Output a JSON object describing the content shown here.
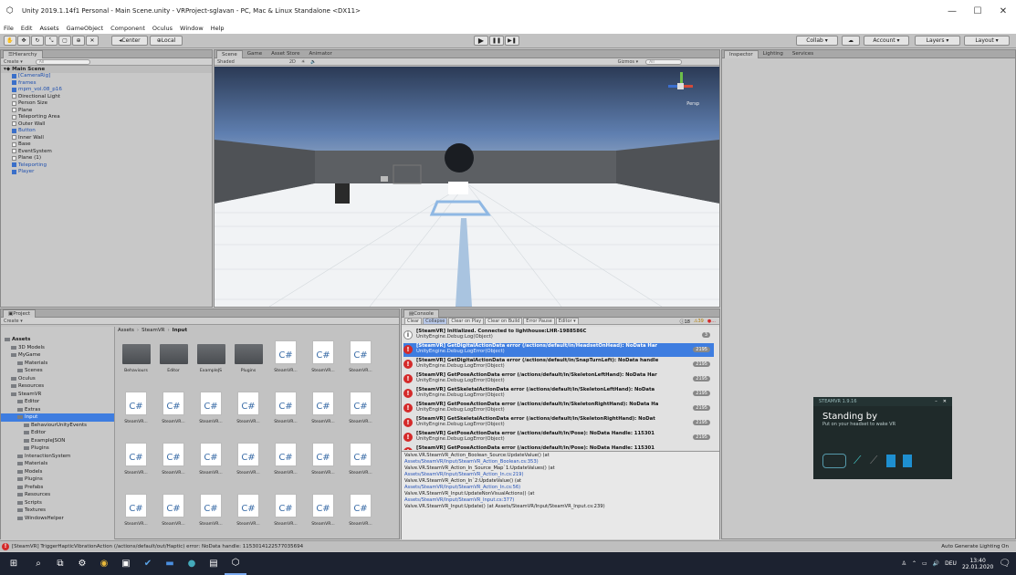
{
  "window": {
    "title": "Unity 2019.1.14f1 Personal - Main Scene.unity - VRProject-sglavan - PC, Mac & Linux Standalone <DX11>",
    "controls": {
      "minimize": "—",
      "maximize": "☐",
      "close": "✕"
    }
  },
  "menu": [
    "File",
    "Edit",
    "Assets",
    "GameObject",
    "Component",
    "Oculus",
    "Window",
    "Help"
  ],
  "toolbar": {
    "pivot": "Center",
    "space": "Local",
    "collab": "Collab ▾",
    "account": "Account ▾",
    "layers": "Layers ▾",
    "layout": "Layout ▾",
    "play": "▶",
    "pause": "❚❚",
    "step": "▶❚"
  },
  "hierarchy": {
    "tab": "Hierarchy",
    "create": "Create ▾",
    "search_placeholder": "All",
    "scene": "Main Scene",
    "items": [
      {
        "label": "[CameraRig]",
        "indent": 1,
        "blue": true
      },
      {
        "label": "frames",
        "indent": 1,
        "blue": true
      },
      {
        "label": "mpm_vol.08_p16",
        "indent": 1,
        "blue": true
      },
      {
        "label": "Directional Light",
        "indent": 1,
        "blue": false
      },
      {
        "label": "Person Size",
        "indent": 1,
        "blue": false
      },
      {
        "label": "Plane",
        "indent": 1,
        "blue": false
      },
      {
        "label": "Teleporting Area",
        "indent": 1,
        "blue": false
      },
      {
        "label": "Outer Wall",
        "indent": 1,
        "blue": false
      },
      {
        "label": "Button",
        "indent": 1,
        "blue": true
      },
      {
        "label": "Inner Wall",
        "indent": 1,
        "blue": false
      },
      {
        "label": "Base",
        "indent": 1,
        "blue": false
      },
      {
        "label": "EventSystem",
        "indent": 1,
        "blue": false
      },
      {
        "label": "Plane (1)",
        "indent": 1,
        "blue": false
      },
      {
        "label": "Teleporting",
        "indent": 1,
        "blue": true
      },
      {
        "label": "Player",
        "indent": 1,
        "blue": true
      }
    ]
  },
  "scene_view": {
    "tabs": [
      "Scene",
      "Game",
      "Asset Store",
      "Animator"
    ],
    "shading": "Shaded",
    "mode_2d": "2D",
    "gizmos": "Gizmos ▾",
    "search_placeholder": "All",
    "persp": "Persp"
  },
  "inspector": {
    "tabs": [
      "Inspector",
      "Lighting",
      "Services"
    ]
  },
  "project": {
    "tab": "Project",
    "create": "Create ▾",
    "breadcrumb": [
      "Assets",
      "SteamVR",
      "Input"
    ],
    "tree": [
      {
        "label": "Assets",
        "indent": 0,
        "bold": true
      },
      {
        "label": "3D Models",
        "indent": 1
      },
      {
        "label": "MyGame",
        "indent": 1
      },
      {
        "label": "Materials",
        "indent": 2
      },
      {
        "label": "Scenes",
        "indent": 2
      },
      {
        "label": "Oculus",
        "indent": 1
      },
      {
        "label": "Resources",
        "indent": 1
      },
      {
        "label": "SteamVR",
        "indent": 1
      },
      {
        "label": "Editor",
        "indent": 2
      },
      {
        "label": "Extras",
        "indent": 2
      },
      {
        "label": "Input",
        "indent": 2,
        "selected": true
      },
      {
        "label": "BehaviourUnityEvents",
        "indent": 3
      },
      {
        "label": "Editor",
        "indent": 3
      },
      {
        "label": "ExampleJSON",
        "indent": 3
      },
      {
        "label": "Plugins",
        "indent": 3
      },
      {
        "label": "InteractionSystem",
        "indent": 2
      },
      {
        "label": "Materials",
        "indent": 2
      },
      {
        "label": "Models",
        "indent": 2
      },
      {
        "label": "Plugins",
        "indent": 2
      },
      {
        "label": "Prefabs",
        "indent": 2
      },
      {
        "label": "Resources",
        "indent": 2
      },
      {
        "label": "Scripts",
        "indent": 2
      },
      {
        "label": "Textures",
        "indent": 2
      },
      {
        "label": "WindowsHelper",
        "indent": 2
      }
    ],
    "assets": [
      {
        "label": "Behaviours",
        "type": "folder"
      },
      {
        "label": "Editor",
        "type": "folder"
      },
      {
        "label": "ExampleJS",
        "type": "folder"
      },
      {
        "label": "Plugins",
        "type": "folder"
      },
      {
        "label": "SteamVR...",
        "type": "cs"
      },
      {
        "label": "SteamVR...",
        "type": "cs"
      },
      {
        "label": "SteamVR...",
        "type": "cs"
      },
      {
        "label": "SteamVR...",
        "type": "cs"
      },
      {
        "label": "SteamVR...",
        "type": "cs"
      },
      {
        "label": "SteamVR...",
        "type": "cs"
      },
      {
        "label": "SteamVR...",
        "type": "cs"
      },
      {
        "label": "SteamVR...",
        "type": "cs"
      },
      {
        "label": "SteamVR...",
        "type": "cs"
      },
      {
        "label": "SteamVR...",
        "type": "cs"
      },
      {
        "label": "SteamVR...",
        "type": "cs"
      },
      {
        "label": "SteamVR...",
        "type": "cs"
      },
      {
        "label": "SteamVR...",
        "type": "cs"
      },
      {
        "label": "SteamVR...",
        "type": "cs"
      },
      {
        "label": "SteamVR...",
        "type": "cs"
      },
      {
        "label": "SteamVR...",
        "type": "cs"
      },
      {
        "label": "SteamVR...",
        "type": "cs"
      },
      {
        "label": "SteamVR...",
        "type": "cs"
      },
      {
        "label": "SteamVR...",
        "type": "cs"
      },
      {
        "label": "SteamVR...",
        "type": "cs"
      },
      {
        "label": "SteamVR...",
        "type": "cs"
      },
      {
        "label": "SteamVR...",
        "type": "cs"
      },
      {
        "label": "SteamVR...",
        "type": "cs"
      },
      {
        "label": "SteamVR...",
        "type": "cs"
      }
    ],
    "cs_glyph": "C#"
  },
  "console": {
    "tab": "Console",
    "buttons": [
      "Clear",
      "Collapse",
      "Clear on Play",
      "Clear on Build",
      "Error Pause",
      "Editor ▾"
    ],
    "counts": {
      "info": "18",
      "warn": "39",
      "error": "..."
    },
    "entries": [
      {
        "level": "info",
        "title": "[SteamVR] Initialized. Connected to lighthouse:LHR-1988586C",
        "sub": "UnityEngine.Debug:Log(Object)",
        "count": "3"
      },
      {
        "level": "error",
        "title": "[SteamVR] GetDigitalActionData error (/actions/default/in/HeadsetOnHead): NoData Har",
        "sub": "UnityEngine.Debug:LogError(Object)",
        "count": "2195",
        "selected": true
      },
      {
        "level": "error",
        "title": "[SteamVR] GetDigitalActionData error (/actions/default/in/SnapTurnLeft): NoData handle",
        "sub": "UnityEngine.Debug:LogError(Object)",
        "count": "2195"
      },
      {
        "level": "error",
        "title": "[SteamVR] GetPoseActionData error (/actions/default/in/SkeletonLeftHand): NoData Har",
        "sub": "UnityEngine.Debug:LogError(Object)",
        "count": "2195"
      },
      {
        "level": "error",
        "title": "[SteamVR] GetSkeletalActionData error (/actions/default/in/SkeletonLeftHand): NoData",
        "sub": "UnityEngine.Debug:LogError(Object)",
        "count": "2195"
      },
      {
        "level": "error",
        "title": "[SteamVR] GetPoseActionData error (/actions/default/in/SkeletonRightHand): NoData Ha",
        "sub": "UnityEngine.Debug:LogError(Object)",
        "count": "2195"
      },
      {
        "level": "error",
        "title": "[SteamVR] GetSkeletalActionData error (/actions/default/in/SkeletonRightHand): NoDat",
        "sub": "UnityEngine.Debug:LogError(Object)",
        "count": "2195"
      },
      {
        "level": "error",
        "title": "[SteamVR] GetPoseActionData error (/actions/default/in/Pose): NoData Handle: 115301",
        "sub": "UnityEngine.Debug:LogError(Object)",
        "count": "2195"
      },
      {
        "level": "error",
        "title": "[SteamVR] GetPoseActionData error (/actions/default/in/Pose): NoData Handle: 115301",
        "sub": "",
        "count": ""
      }
    ],
    "stack": [
      {
        "text": "Valve.VR.SteamVR_Action_Boolean_Source:UpdateValue() (at",
        "link": false
      },
      {
        "text": "Assets/SteamVR/Input/SteamVR_Action_Boolean.cs:353)",
        "link": true
      },
      {
        "text": "Valve.VR.SteamVR_Action_In_Source_Map`1:UpdateValues() (at",
        "link": false
      },
      {
        "text": "Assets/SteamVR/Input/SteamVR_Action_In.cs:219)",
        "link": true
      },
      {
        "text": "Valve.VR.SteamVR_Action_In`2:UpdateValue() (at",
        "link": false
      },
      {
        "text": "Assets/SteamVR/Input/SteamVR_Action_In.cs:56)",
        "link": true
      },
      {
        "text": "Valve.VR.SteamVR_Input:UpdateNonVisualActions() (at",
        "link": false
      },
      {
        "text": "Assets/SteamVR/Input/SteamVR_Input.cs:377)",
        "link": true
      },
      {
        "text": "Valve.VR.SteamVR_Input:Update() (at Assets/SteamVR/Input/SteamVR_Input.cs:239)",
        "link": false
      }
    ]
  },
  "statusbar": {
    "message": "[SteamVR] TriggerHapticVibrationAction (/actions/default/out/Haptic) error: NoData handle: 1153014122577035694",
    "right": "Auto Generate Lighting On"
  },
  "steamvr_overlay": {
    "header": "STEAMVR 1.9.16",
    "title": "Standing by",
    "subtitle": "Put on your headset to wake VR"
  },
  "taskbar": {
    "lang": "DEU",
    "time": "13:40",
    "date": "22.01.2020"
  },
  "colors": {
    "accent": "#3a72d8",
    "error": "#d42a2a",
    "selection": "#3e7de0"
  }
}
